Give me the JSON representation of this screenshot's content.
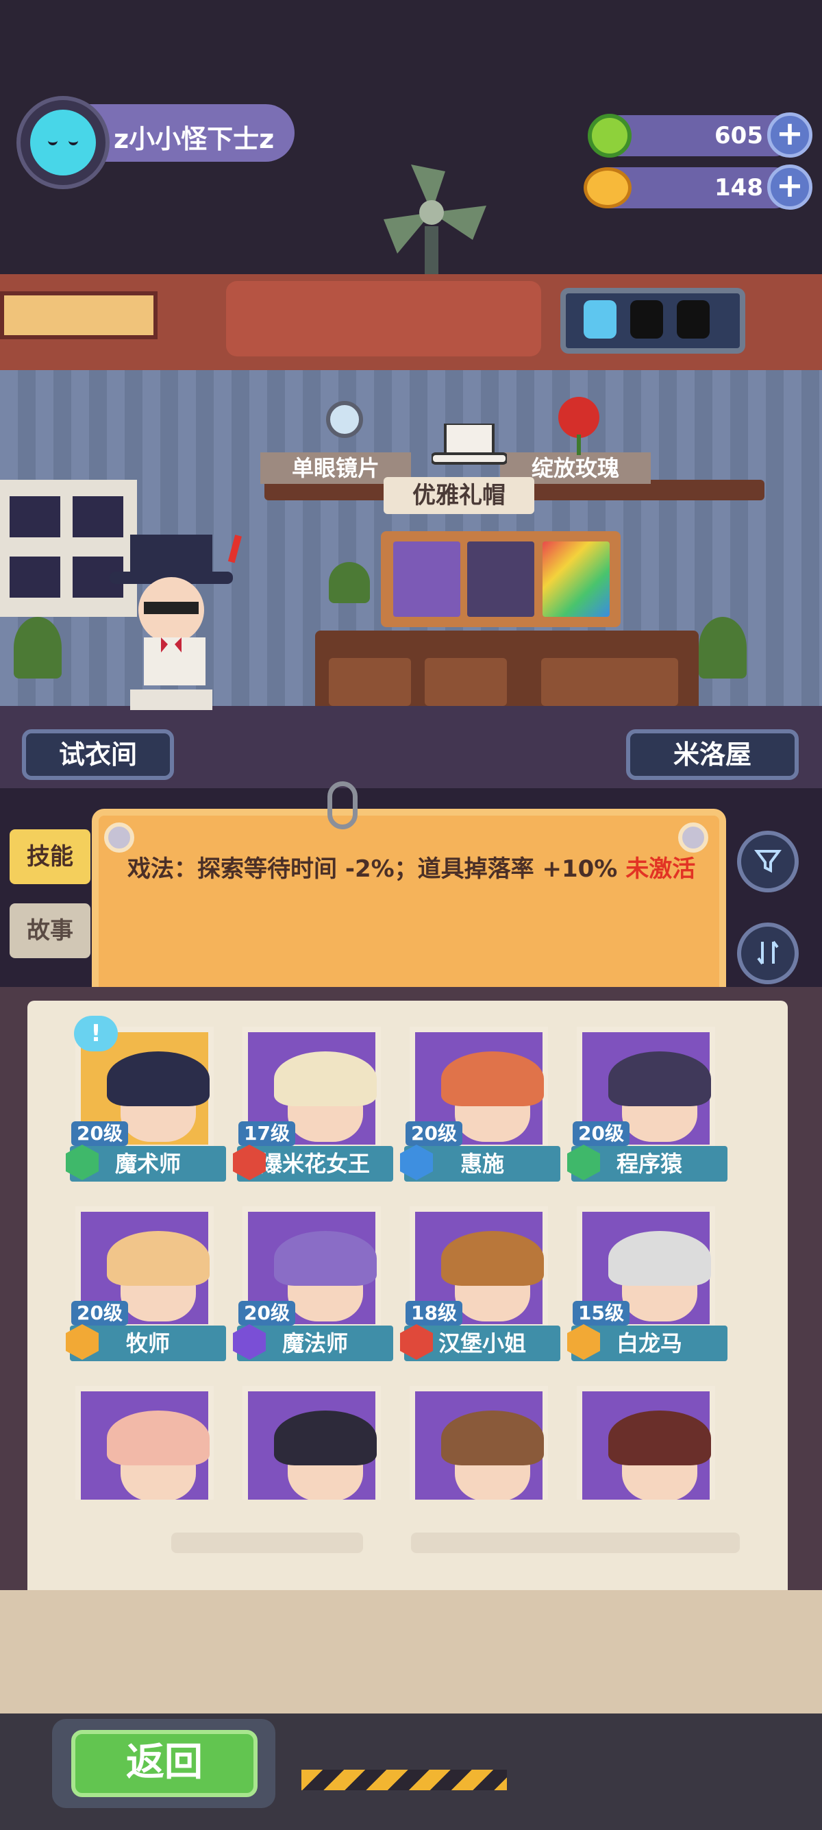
{
  "profile": {
    "name": "z小小怪下士z",
    "avatar_icon": "cat-face-icon"
  },
  "resources": [
    {
      "name": "green-coin",
      "icon": "green-coin-icon",
      "value": "605",
      "plus": "+"
    },
    {
      "name": "planet-coin",
      "icon": "planet-coin-icon",
      "value": "148",
      "plus": "+"
    }
  ],
  "room": {
    "shelf_items": [
      "单眼镜片",
      "优雅礼帽",
      "绽放玫瑰"
    ],
    "left_nav": "试衣间",
    "right_nav": "米洛屋"
  },
  "tabs": {
    "skill": "技能",
    "story": "故事"
  },
  "skill": {
    "text": "戏法：探索等待时间 -2%；道具掉落率 +10%",
    "status": "未激活"
  },
  "controls": {
    "filter_icon": "filter-icon",
    "sort_icon": "sort-icon"
  },
  "selected_marker": "!",
  "characters": [
    {
      "level": "20级",
      "name": "魔术师",
      "badge_color": "#3fb86a",
      "selected": true
    },
    {
      "level": "17级",
      "name": "爆米花女王",
      "badge_color": "#e0493a"
    },
    {
      "level": "20级",
      "name": "惠施",
      "badge_color": "#3e8fe0"
    },
    {
      "level": "20级",
      "name": "程序猿",
      "badge_color": "#3fb86a"
    },
    {
      "level": "20级",
      "name": "牧师",
      "badge_color": "#f2a935"
    },
    {
      "level": "20级",
      "name": "魔法师",
      "badge_color": "#7a4fd6"
    },
    {
      "level": "18级",
      "name": "汉堡小姐",
      "badge_color": "#e0493a"
    },
    {
      "level": "15级",
      "name": "白龙马",
      "badge_color": "#f2a935"
    },
    {
      "level": "",
      "name": "",
      "badge_color": "#3e8fe0"
    },
    {
      "level": "",
      "name": "",
      "badge_color": "#3e8fe0"
    },
    {
      "level": "",
      "name": "",
      "badge_color": "#3e8fe0"
    },
    {
      "level": "",
      "name": "",
      "badge_color": "#3e8fe0"
    }
  ],
  "footer": {
    "back_label": "返回"
  },
  "colors": {
    "accent_red": "#e23324",
    "card": "#f5b35a",
    "tile_bar": "#3f8ea8"
  }
}
